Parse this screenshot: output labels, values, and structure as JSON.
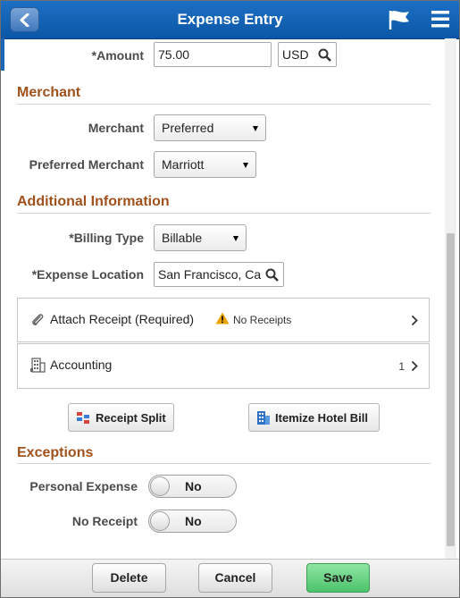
{
  "header": {
    "title": "Expense Entry"
  },
  "form": {
    "amount_label": "*Amount",
    "amount_value": "75.00",
    "currency_value": "USD"
  },
  "merchant_section": {
    "title": "Merchant",
    "merchant_label": "Merchant",
    "merchant_value": "Preferred",
    "preferred_label": "Preferred Merchant",
    "preferred_value": "Marriott"
  },
  "additional_section": {
    "title": "Additional Information",
    "billing_label": "*Billing Type",
    "billing_value": "Billable",
    "location_label": "*Expense Location",
    "location_value": "San Francisco, Ca"
  },
  "attach_panel": {
    "label": "Attach Receipt (Required)",
    "status": "No Receipts"
  },
  "accounting_panel": {
    "label": "Accounting",
    "count": "1"
  },
  "actions": {
    "receipt_split": "Receipt Split",
    "itemize_hotel": "Itemize Hotel Bill"
  },
  "exceptions_section": {
    "title": "Exceptions",
    "personal_label": "Personal Expense",
    "personal_value": "No",
    "no_receipt_label": "No Receipt",
    "no_receipt_value": "No"
  },
  "footer": {
    "delete": "Delete",
    "cancel": "Cancel",
    "save": "Save"
  },
  "colors": {
    "header": "#0b56a6",
    "section_title": "#a0521d",
    "save_button": "#4cc36b",
    "warning": "#e8a400"
  }
}
